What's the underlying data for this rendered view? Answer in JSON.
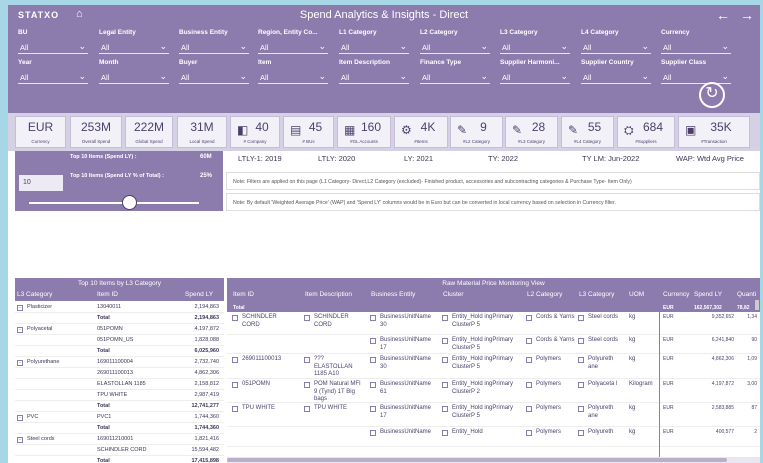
{
  "app": {
    "logo": "STATXO",
    "title": "Spend Analytics & Insights - Direct",
    "back_icon": "←",
    "forward_icon": "→",
    "home_icon": "⌂"
  },
  "filters": [
    {
      "label": "BU",
      "value": "All"
    },
    {
      "label": "Legal Entity",
      "value": "All"
    },
    {
      "label": "Business Entity",
      "value": "All"
    },
    {
      "label": "Region, Entity Co...",
      "value": "All"
    },
    {
      "label": "L1 Category",
      "value": "All"
    },
    {
      "label": "L2 Category",
      "value": "All"
    },
    {
      "label": "L3 Category",
      "value": "All"
    },
    {
      "label": "L4 Category",
      "value": "All"
    },
    {
      "label": "Currency",
      "value": "All"
    },
    {
      "label": "Year",
      "value": "All"
    },
    {
      "label": "Month",
      "value": "All"
    },
    {
      "label": "Buyer",
      "value": "All"
    },
    {
      "label": "Item",
      "value": "All"
    },
    {
      "label": "Item Description",
      "value": "All"
    },
    {
      "label": "Finance Type",
      "value": "All"
    },
    {
      "label": "Supplier Harmoni...",
      "value": "All"
    },
    {
      "label": "Supplier Country",
      "value": "All"
    },
    {
      "label": "Supplier Class",
      "value": "All"
    }
  ],
  "kpis": [
    {
      "value": "EUR",
      "label": "Currency"
    },
    {
      "value": "253M",
      "label": "Overall Spend"
    },
    {
      "value": "222M",
      "label": "Global Spend"
    },
    {
      "value": "31M",
      "label": "Local Spend"
    },
    {
      "value": "40",
      "label": "# Company"
    },
    {
      "value": "45",
      "label": "# BUs"
    },
    {
      "value": "160",
      "label": "#GL Accounts"
    },
    {
      "value": "4K",
      "label": "#Items"
    },
    {
      "value": "9",
      "label": "#L2 Category"
    },
    {
      "value": "28",
      "label": "#L3 Category"
    },
    {
      "value": "55",
      "label": "#L4 Category"
    },
    {
      "value": "684",
      "label": "#Suppliers"
    },
    {
      "value": "35K",
      "label": "#Transaction"
    }
  ],
  "top_items": {
    "label1": "Top 10 Items (Spend LY) :",
    "value1": "60M",
    "label2": "Top 10 Items (Spend LY % of Total) :",
    "value2": "25%",
    "n": "10"
  },
  "periods": {
    "ltly1": "LTLY-1: 2019",
    "ltly": "LTLY: 2020",
    "ly": "LY: 2021",
    "ty": "TY: 2022",
    "tylm": "TY LM: Jun-2022",
    "wap": "WAP: Wtd Avg Price"
  },
  "notes": {
    "note1": "Note: Filters are applied on this page (L1 Category- Direct,L2 Category (excluded)- Finished product, accessories and subcontracting categories & Purchase Type- Item Only)",
    "note2": "Note: By default 'Weighted Average Price' (WAP) and 'Spend LY' columns would be in Euro but can be converted in local currency based on selection in Currency filter."
  },
  "left_table": {
    "title": "Top 10 Items by L3 Category",
    "headers": [
      "L3 Category",
      "Item ID",
      "Spend LY"
    ],
    "rows": [
      {
        "cat": "Plasticizer",
        "id": "13040011",
        "spend": "2,194,863",
        "bold": false
      },
      {
        "cat": "",
        "id": "Total",
        "spend": "2,194,863",
        "bold": true
      },
      {
        "cat": "Polyacetal",
        "id": "051POMN",
        "spend": "4,197,872",
        "bold": false
      },
      {
        "cat": "",
        "id": "051POMN_US",
        "spend": "1,828,088",
        "bold": false
      },
      {
        "cat": "",
        "id": "Total",
        "spend": "6,025,960",
        "bold": true
      },
      {
        "cat": "Polyurethane",
        "id": "169011100004",
        "spend": "2,732,740",
        "bold": false
      },
      {
        "cat": "",
        "id": "269011100013",
        "spend": "4,862,306",
        "bold": false
      },
      {
        "cat": "",
        "id": "ELASTOLLAN 1185",
        "spend": "2,158,812",
        "bold": false
      },
      {
        "cat": "",
        "id": "TPU WHITE",
        "spend": "2,987,419",
        "bold": false
      },
      {
        "cat": "",
        "id": "Total",
        "spend": "12,741,277",
        "bold": true
      },
      {
        "cat": "PVC",
        "id": "PVC1",
        "spend": "1,744,360",
        "bold": false
      },
      {
        "cat": "",
        "id": "Total",
        "spend": "1,744,360",
        "bold": true
      },
      {
        "cat": "Steel cords",
        "id": "169011210001",
        "spend": "1,821,416",
        "bold": false
      },
      {
        "cat": "",
        "id": "SCHINDLER CORD",
        "spend": "15,594,482",
        "bold": false
      },
      {
        "cat": "",
        "id": "Total",
        "spend": "17,415,898",
        "bold": true
      }
    ]
  },
  "right_table": {
    "title": "Raw Material Price Monitoring View",
    "headers": [
      "Item ID",
      "Item Description",
      "Business Entity",
      "Cluster",
      "L2 Category",
      "L3 Category",
      "UOM",
      "Currency",
      "Spend LY",
      "Quanti"
    ],
    "total": {
      "label": "Total",
      "currency": "EUR",
      "spend": "162,567,302",
      "qty": "78,82"
    },
    "rows": [
      {
        "id": "SCHINDLER CORD",
        "desc": "SCHINDLER CORD",
        "be": "BusinessUnitName 30",
        "cluster": "Entity_Hold ingPrimary ClusterP 5",
        "l2": "Cords & Yarns",
        "l3": "Steel cords",
        "uom": "kg",
        "cur": "EUR",
        "spend": "9,352,652",
        "qty": "1,34"
      },
      {
        "id": "",
        "desc": "",
        "be": "BusinessUnitName 17",
        "cluster": "Entity_Hold ingPrimary ClusterP 5",
        "l2": "Cords & Yarns",
        "l3": "Steel cords",
        "uom": "kg",
        "cur": "EUR",
        "spend": "6,241,840",
        "qty": "90"
      },
      {
        "id": "269011100013",
        "desc": "??? ELASTOLLAN 1185 A10",
        "be": "BusinessUnitName 30",
        "cluster": "Entity_Hold ingPrimary ClusterP 5",
        "l2": "Polymers",
        "l3": "Polyureth ane",
        "uom": "kg",
        "cur": "EUR",
        "spend": "4,862,306",
        "qty": "1,09"
      },
      {
        "id": "051POMN",
        "desc": "POM Natural MFI 9 (Tynd) 1T Big bags",
        "be": "BusinessUnitName 61",
        "cluster": "Entity_Hold ingPrimary ClusterP 2",
        "l2": "Polymers",
        "l3": "Polyaceta l",
        "uom": "Kilogram",
        "cur": "EUR",
        "spend": "4,197,872",
        "qty": "3,00"
      },
      {
        "id": "TPU WHITE",
        "desc": "TPU WHITE",
        "be": "BusinessUnitName 17",
        "cluster": "Entity_Hold ingPrimary ClusterP 5",
        "l2": "Polymers",
        "l3": "Polyureth ane",
        "uom": "kg",
        "cur": "EUR",
        "spend": "2,583,885",
        "qty": "87"
      },
      {
        "id": "",
        "desc": "",
        "be": "BusinessUnitName",
        "cluster": "Entity_Hold",
        "l2": "Polymers",
        "l3": "Polyureth",
        "uom": "kg",
        "cur": "EUR",
        "spend": "400,577",
        "qty": "2"
      }
    ]
  }
}
